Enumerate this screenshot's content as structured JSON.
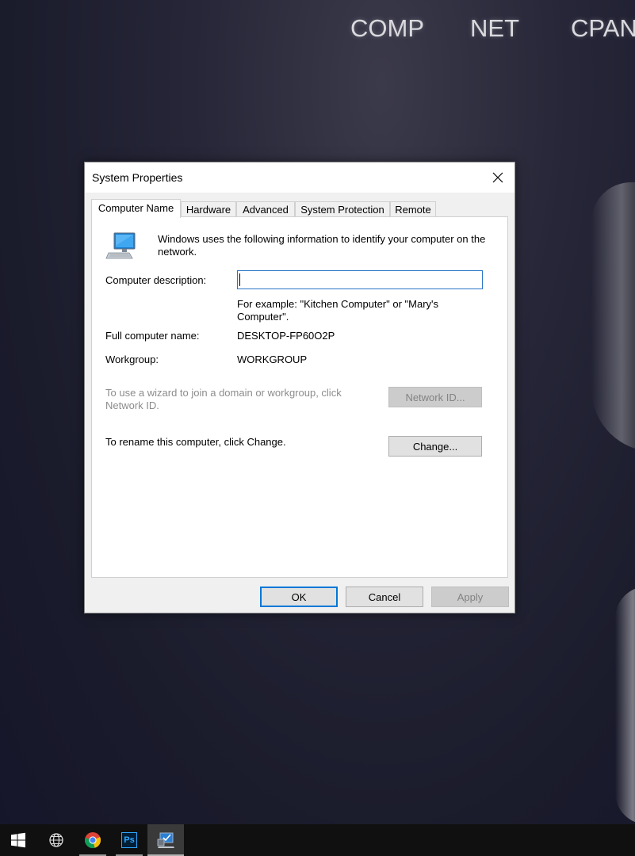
{
  "wallpaper": {
    "labels": [
      "COMP",
      "NET",
      "CPAN"
    ]
  },
  "dialog": {
    "title": "System Properties",
    "tabs": [
      {
        "label": "Computer Name",
        "active": true
      },
      {
        "label": "Hardware",
        "active": false
      },
      {
        "label": "Advanced",
        "active": false
      },
      {
        "label": "System Protection",
        "active": false
      },
      {
        "label": "Remote",
        "active": false
      }
    ],
    "info_text": "Windows uses the following information to identify your computer on the network.",
    "description_label": "Computer description:",
    "description_value": "",
    "example_text": "For example: \"Kitchen Computer\" or \"Mary's Computer\".",
    "full_name_label": "Full computer name:",
    "full_name_value": "DESKTOP-FP60O2P",
    "workgroup_label": "Workgroup:",
    "workgroup_value": "WORKGROUP",
    "wizard_text": "To use a wizard to join a domain or workgroup, click Network ID.",
    "network_id_button": "Network ID...",
    "rename_text": "To rename this computer, click Change.",
    "change_button": "Change...",
    "ok_button": "OK",
    "cancel_button": "Cancel",
    "apply_button": "Apply"
  },
  "taskbar": {
    "items": [
      "start-icon",
      "network-globe-icon",
      "chrome-icon",
      "photoshop-icon",
      "system-properties-icon"
    ],
    "photoshop_label": "Ps"
  },
  "colors": {
    "accent": "#0078d7",
    "input_border": "#2a75c7",
    "taskbar": "#101010"
  }
}
